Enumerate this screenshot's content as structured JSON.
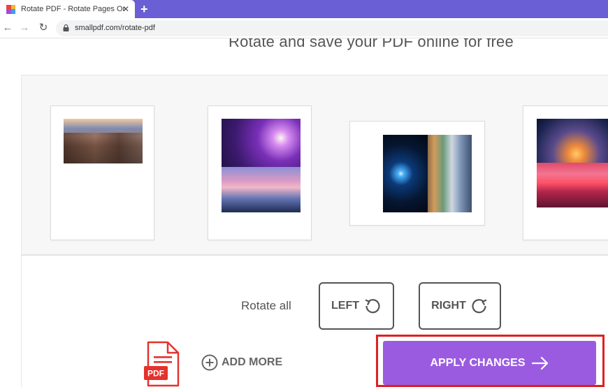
{
  "browser": {
    "tab_title": "Rotate PDF - Rotate Pages Online",
    "close_glyph": "✕",
    "new_tab_glyph": "+",
    "back_glyph": "←",
    "forward_glyph": "→",
    "reload_glyph": "↻",
    "url": "smallpdf.com/rotate-pdf"
  },
  "page": {
    "heading": "Rotate and save your PDF online for free"
  },
  "controls": {
    "rotate_all_label": "Rotate all",
    "left_label": "LEFT",
    "right_label": "RIGHT",
    "add_more_label": "ADD MORE",
    "apply_label": "APPLY CHANGES",
    "pdf_badge": "PDF"
  },
  "colors": {
    "tab_strip": "#6a5fd4",
    "apply_button": "#9b5be0",
    "highlight": "#e02020",
    "pdf_red": "#e5322d"
  }
}
